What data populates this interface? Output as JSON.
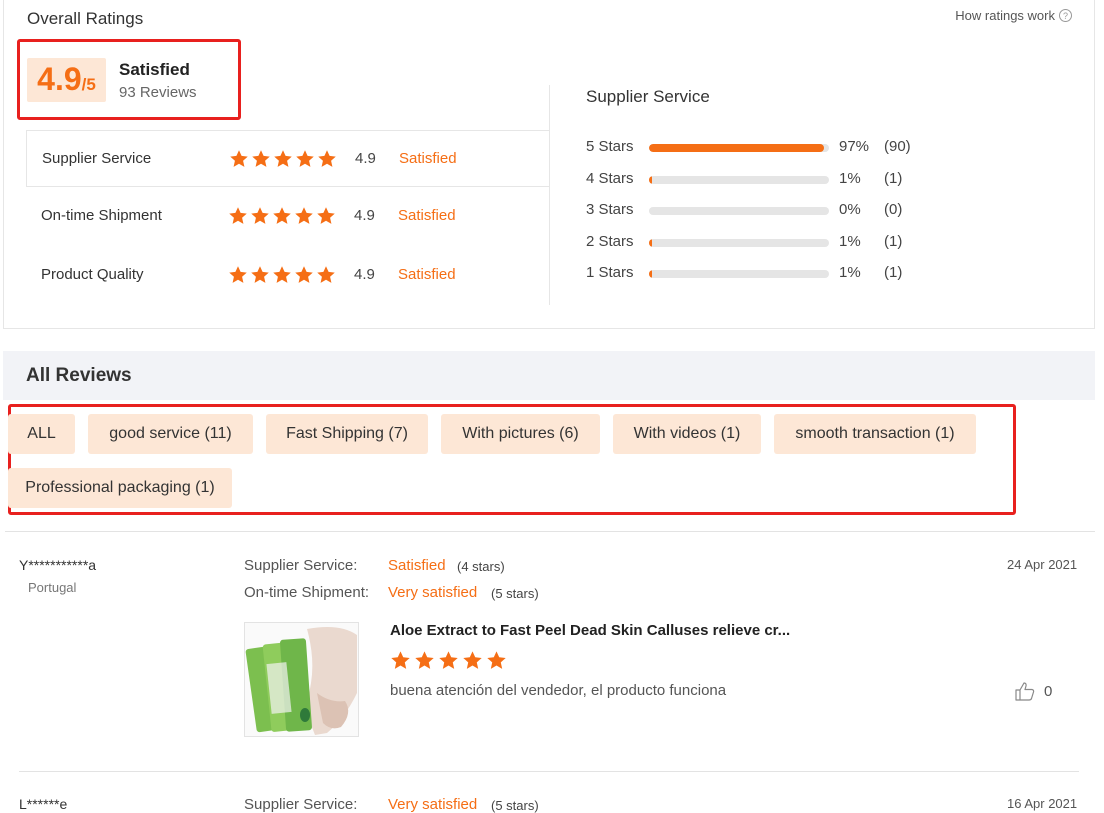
{
  "overall": {
    "title": "Overall Ratings",
    "how_link": "How ratings work",
    "help_icon": "?",
    "score": "4.9",
    "score_den": "/5",
    "label": "Satisfied",
    "reviews": "93 Reviews"
  },
  "categories": [
    {
      "name": "Supplier Service",
      "value": "4.9",
      "label": "Satisfied",
      "stars": 5
    },
    {
      "name": "On-time Shipment",
      "value": "4.9",
      "label": "Satisfied",
      "stars": 5
    },
    {
      "name": "Product Quality",
      "value": "4.9",
      "label": "Satisfied",
      "stars": 5
    }
  ],
  "supplier_service": {
    "title": "Supplier Service",
    "rows": [
      {
        "label": "5  Stars",
        "percent": "97%",
        "count": "(90)",
        "fill": 0.97
      },
      {
        "label": "4  Stars",
        "percent": "1%",
        "count": "(1)",
        "fill": 0.01
      },
      {
        "label": "3  Stars",
        "percent": "0%",
        "count": "(0)",
        "fill": 0.0
      },
      {
        "label": "2  Stars",
        "percent": "1%",
        "count": "(1)",
        "fill": 0.01
      },
      {
        "label": "1  Stars",
        "percent": "1%",
        "count": "(1)",
        "fill": 0.01
      }
    ]
  },
  "all_reviews": {
    "title": "All Reviews",
    "tags": [
      "ALL",
      "good service (11)",
      "Fast Shipping (7)",
      "With pictures (6)",
      "With videos (1)",
      "smooth transaction (1)",
      "Professional packaging (1)"
    ]
  },
  "reviews": [
    {
      "reviewer": "Y***********a",
      "country": "Portugal",
      "date": "24 Apr 2021",
      "supplier_label": "Supplier Service:",
      "supplier_value": "Satisfied",
      "supplier_stars": "(4 stars)",
      "shipment_label": "On-time Shipment:",
      "shipment_value": "Very satisfied",
      "shipment_stars": "(5 stars)",
      "product_title": "Aloe Extract to Fast Peel Dead Skin Calluses relieve cr...",
      "product_rating": 5,
      "text": "buena atención del vendedor, el producto funciona",
      "likes": "0"
    },
    {
      "reviewer": "L******e",
      "date": "16 Apr 2021",
      "supplier_label": "Supplier Service:",
      "supplier_value": "Very satisfied",
      "supplier_stars": "(5 stars)"
    }
  ],
  "colors": {
    "accent": "#f56e15",
    "highlight_border": "#e8201e",
    "tag_bg": "#fde7d6"
  }
}
